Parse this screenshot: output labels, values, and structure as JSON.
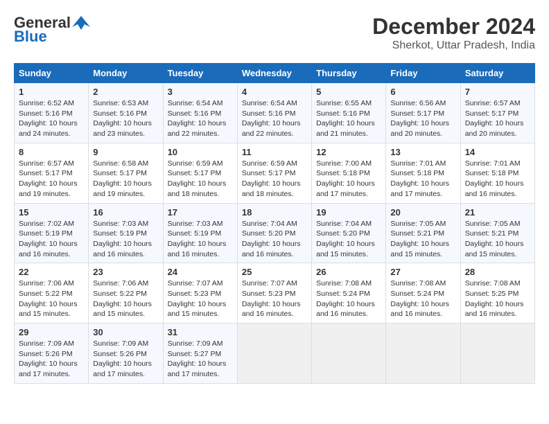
{
  "logo": {
    "general": "General",
    "blue": "Blue"
  },
  "title": "December 2024",
  "subtitle": "Sherkot, Uttar Pradesh, India",
  "headers": [
    "Sunday",
    "Monday",
    "Tuesday",
    "Wednesday",
    "Thursday",
    "Friday",
    "Saturday"
  ],
  "weeks": [
    [
      {
        "day": "1",
        "sunrise": "Sunrise: 6:52 AM",
        "sunset": "Sunset: 5:16 PM",
        "daylight": "Daylight: 10 hours and 24 minutes."
      },
      {
        "day": "2",
        "sunrise": "Sunrise: 6:53 AM",
        "sunset": "Sunset: 5:16 PM",
        "daylight": "Daylight: 10 hours and 23 minutes."
      },
      {
        "day": "3",
        "sunrise": "Sunrise: 6:54 AM",
        "sunset": "Sunset: 5:16 PM",
        "daylight": "Daylight: 10 hours and 22 minutes."
      },
      {
        "day": "4",
        "sunrise": "Sunrise: 6:54 AM",
        "sunset": "Sunset: 5:16 PM",
        "daylight": "Daylight: 10 hours and 22 minutes."
      },
      {
        "day": "5",
        "sunrise": "Sunrise: 6:55 AM",
        "sunset": "Sunset: 5:16 PM",
        "daylight": "Daylight: 10 hours and 21 minutes."
      },
      {
        "day": "6",
        "sunrise": "Sunrise: 6:56 AM",
        "sunset": "Sunset: 5:17 PM",
        "daylight": "Daylight: 10 hours and 20 minutes."
      },
      {
        "day": "7",
        "sunrise": "Sunrise: 6:57 AM",
        "sunset": "Sunset: 5:17 PM",
        "daylight": "Daylight: 10 hours and 20 minutes."
      }
    ],
    [
      {
        "day": "8",
        "sunrise": "Sunrise: 6:57 AM",
        "sunset": "Sunset: 5:17 PM",
        "daylight": "Daylight: 10 hours and 19 minutes."
      },
      {
        "day": "9",
        "sunrise": "Sunrise: 6:58 AM",
        "sunset": "Sunset: 5:17 PM",
        "daylight": "Daylight: 10 hours and 19 minutes."
      },
      {
        "day": "10",
        "sunrise": "Sunrise: 6:59 AM",
        "sunset": "Sunset: 5:17 PM",
        "daylight": "Daylight: 10 hours and 18 minutes."
      },
      {
        "day": "11",
        "sunrise": "Sunrise: 6:59 AM",
        "sunset": "Sunset: 5:17 PM",
        "daylight": "Daylight: 10 hours and 18 minutes."
      },
      {
        "day": "12",
        "sunrise": "Sunrise: 7:00 AM",
        "sunset": "Sunset: 5:18 PM",
        "daylight": "Daylight: 10 hours and 17 minutes."
      },
      {
        "day": "13",
        "sunrise": "Sunrise: 7:01 AM",
        "sunset": "Sunset: 5:18 PM",
        "daylight": "Daylight: 10 hours and 17 minutes."
      },
      {
        "day": "14",
        "sunrise": "Sunrise: 7:01 AM",
        "sunset": "Sunset: 5:18 PM",
        "daylight": "Daylight: 10 hours and 16 minutes."
      }
    ],
    [
      {
        "day": "15",
        "sunrise": "Sunrise: 7:02 AM",
        "sunset": "Sunset: 5:19 PM",
        "daylight": "Daylight: 10 hours and 16 minutes."
      },
      {
        "day": "16",
        "sunrise": "Sunrise: 7:03 AM",
        "sunset": "Sunset: 5:19 PM",
        "daylight": "Daylight: 10 hours and 16 minutes."
      },
      {
        "day": "17",
        "sunrise": "Sunrise: 7:03 AM",
        "sunset": "Sunset: 5:19 PM",
        "daylight": "Daylight: 10 hours and 16 minutes."
      },
      {
        "day": "18",
        "sunrise": "Sunrise: 7:04 AM",
        "sunset": "Sunset: 5:20 PM",
        "daylight": "Daylight: 10 hours and 16 minutes."
      },
      {
        "day": "19",
        "sunrise": "Sunrise: 7:04 AM",
        "sunset": "Sunset: 5:20 PM",
        "daylight": "Daylight: 10 hours and 15 minutes."
      },
      {
        "day": "20",
        "sunrise": "Sunrise: 7:05 AM",
        "sunset": "Sunset: 5:21 PM",
        "daylight": "Daylight: 10 hours and 15 minutes."
      },
      {
        "day": "21",
        "sunrise": "Sunrise: 7:05 AM",
        "sunset": "Sunset: 5:21 PM",
        "daylight": "Daylight: 10 hours and 15 minutes."
      }
    ],
    [
      {
        "day": "22",
        "sunrise": "Sunrise: 7:06 AM",
        "sunset": "Sunset: 5:22 PM",
        "daylight": "Daylight: 10 hours and 15 minutes."
      },
      {
        "day": "23",
        "sunrise": "Sunrise: 7:06 AM",
        "sunset": "Sunset: 5:22 PM",
        "daylight": "Daylight: 10 hours and 15 minutes."
      },
      {
        "day": "24",
        "sunrise": "Sunrise: 7:07 AM",
        "sunset": "Sunset: 5:23 PM",
        "daylight": "Daylight: 10 hours and 15 minutes."
      },
      {
        "day": "25",
        "sunrise": "Sunrise: 7:07 AM",
        "sunset": "Sunset: 5:23 PM",
        "daylight": "Daylight: 10 hours and 16 minutes."
      },
      {
        "day": "26",
        "sunrise": "Sunrise: 7:08 AM",
        "sunset": "Sunset: 5:24 PM",
        "daylight": "Daylight: 10 hours and 16 minutes."
      },
      {
        "day": "27",
        "sunrise": "Sunrise: 7:08 AM",
        "sunset": "Sunset: 5:24 PM",
        "daylight": "Daylight: 10 hours and 16 minutes."
      },
      {
        "day": "28",
        "sunrise": "Sunrise: 7:08 AM",
        "sunset": "Sunset: 5:25 PM",
        "daylight": "Daylight: 10 hours and 16 minutes."
      }
    ],
    [
      {
        "day": "29",
        "sunrise": "Sunrise: 7:09 AM",
        "sunset": "Sunset: 5:26 PM",
        "daylight": "Daylight: 10 hours and 17 minutes."
      },
      {
        "day": "30",
        "sunrise": "Sunrise: 7:09 AM",
        "sunset": "Sunset: 5:26 PM",
        "daylight": "Daylight: 10 hours and 17 minutes."
      },
      {
        "day": "31",
        "sunrise": "Sunrise: 7:09 AM",
        "sunset": "Sunset: 5:27 PM",
        "daylight": "Daylight: 10 hours and 17 minutes."
      },
      null,
      null,
      null,
      null
    ]
  ]
}
